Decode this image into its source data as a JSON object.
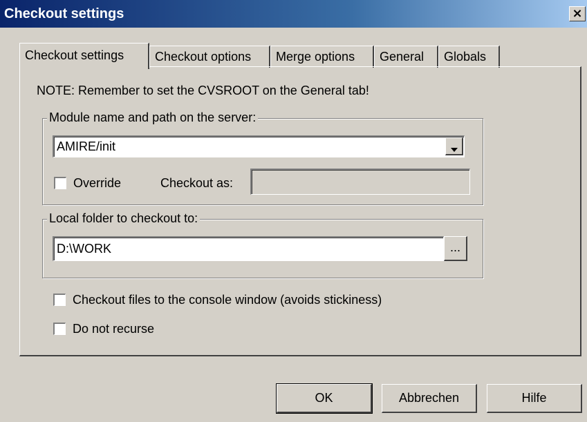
{
  "window": {
    "title": "Checkout settings",
    "close_glyph": "×"
  },
  "tabs": [
    {
      "label": "Checkout settings",
      "active": true
    },
    {
      "label": "Checkout options",
      "active": false
    },
    {
      "label": "Merge options",
      "active": false
    },
    {
      "label": "General",
      "active": false
    },
    {
      "label": "Globals",
      "active": false
    }
  ],
  "note": "NOTE: Remember to set the CVSROOT on the General tab!",
  "module_group": {
    "legend": "Module name and path on the server:",
    "module_value": "AMIRE/init",
    "override_label": "Override",
    "override_checked": false,
    "checkout_as_label": "Checkout as:",
    "checkout_as_value": ""
  },
  "local_group": {
    "legend": "Local folder to checkout to:",
    "folder_value": "D:\\WORK",
    "browse_label": "..."
  },
  "options": {
    "console_label": "Checkout files to the console window (avoids stickiness)",
    "console_checked": false,
    "no_recurse_label": "Do not recurse",
    "no_recurse_checked": false
  },
  "footer": {
    "ok_label": "OK",
    "cancel_label": "Abbrechen",
    "help_label": "Hilfe"
  },
  "colors": {
    "titlebar_start": "#0a246a",
    "titlebar_end": "#a6caf0",
    "face": "#d4d0c8"
  },
  "icons": {
    "close": "close-icon",
    "dropdown": "chevron-down-icon"
  }
}
